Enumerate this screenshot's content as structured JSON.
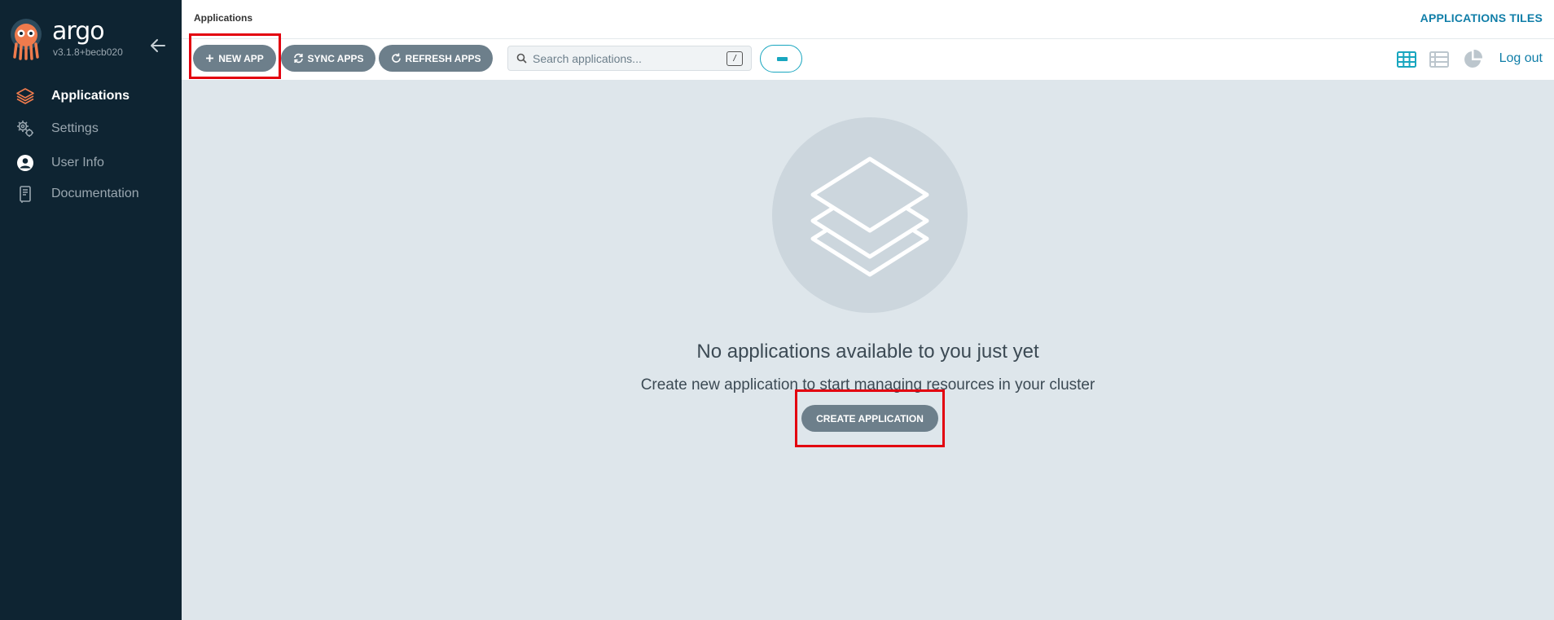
{
  "sidebar": {
    "brand": "argo",
    "version": "v3.1.8+becb020",
    "items": [
      {
        "label": "Applications",
        "icon": "layers-icon",
        "active": true
      },
      {
        "label": "Settings",
        "icon": "gears-icon",
        "active": false
      },
      {
        "label": "User Info",
        "icon": "user-circle-icon",
        "active": false
      },
      {
        "label": "Documentation",
        "icon": "book-icon",
        "active": false
      }
    ]
  },
  "header": {
    "breadcrumb": "Applications",
    "title": "APPLICATIONS TILES"
  },
  "toolbar": {
    "new_app": "NEW APP",
    "sync_apps": "SYNC APPS",
    "refresh_apps": "REFRESH APPS",
    "search_placeholder": "Search applications...",
    "search_shortcut": "/",
    "logout": "Log out"
  },
  "empty_state": {
    "title": "No applications available to you just yet",
    "subtitle": "Create new application to start managing resources in your cluster",
    "button": "CREATE APPLICATION"
  },
  "colors": {
    "sidebar_bg": "#0e2432",
    "accent": "#18a6bf",
    "button_bg": "#6d7f8b",
    "highlight": "#e3000f",
    "logo_orange": "#ef7b4d"
  }
}
